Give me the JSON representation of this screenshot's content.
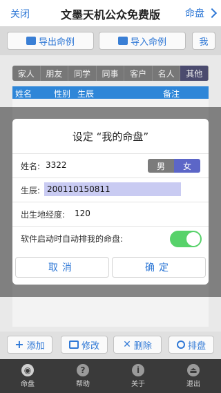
{
  "top": {
    "close": "关闭",
    "title": "文墨天机公众免费版",
    "right": "命盘"
  },
  "toolbar": {
    "export": "导出命例",
    "import": "导入命例",
    "more": "我"
  },
  "tabs": [
    "家人",
    "朋友",
    "同学",
    "同事",
    "客户",
    "名人",
    "其他"
  ],
  "active_tab_index": 6,
  "table_header": [
    "姓名",
    "性别",
    "生辰",
    "备注"
  ],
  "dialog": {
    "title": "设定 “我的命盘”",
    "name_label": "姓名:",
    "name_value": "3322",
    "gender_male": "男",
    "gender_female": "女",
    "gender_selected": "女",
    "dob_label": "生辰:",
    "dob_value": "200110150811",
    "longitude_label": "出生地经度:",
    "longitude_value": "120",
    "autoload_label": "软件启动时自动排我的命盘:",
    "autoload_on": true,
    "cancel": "取消",
    "ok": "确定"
  },
  "actions": {
    "add": "添加",
    "edit": "修改",
    "delete": "删除",
    "arrange": "排盘"
  },
  "bottom_nav": [
    {
      "label": "命盘",
      "icon": "chart-icon",
      "active": true
    },
    {
      "label": "帮助",
      "icon": "help-icon",
      "active": false
    },
    {
      "label": "关于",
      "icon": "info-icon",
      "active": false
    },
    {
      "label": "退出",
      "icon": "exit-icon",
      "active": false
    }
  ],
  "colors": {
    "accent": "#2f78d6",
    "tab_active": "#4b4b6e",
    "header_blue": "#2e86d8",
    "toggle_on": "#57d26a",
    "female_selected": "#5c66c7"
  }
}
